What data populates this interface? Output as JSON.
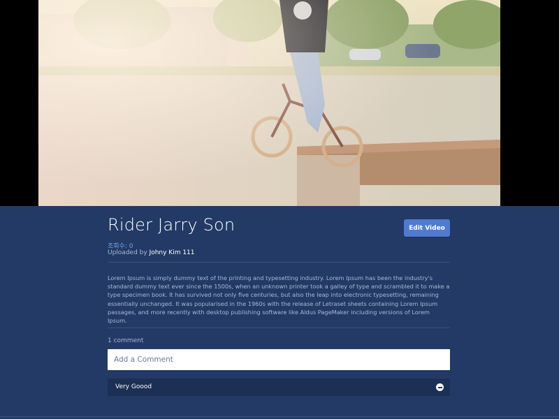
{
  "video": {
    "title": "Rider Jarry Son",
    "views_label": "조회수: 0",
    "uploaded_prefix": "Uploaded by ",
    "uploader": "Johny Kim 111",
    "edit_label": "Edit Video",
    "description": "Lorem Ipsum is simply dummy text of the printing and typesetting industry. Lorem Ipsum has been the industry's standard dummy text ever since the 1500s, when an unknown printer took a galley of type and scrambled it to make a type specimen book. It has survived not only five centuries, but also the leap into electronic typesetting, remaining essentially unchanged. It was popularised in the 1960s with the release of Letraset sheets containing Lorem Ipsum passages, and more recently with desktop publishing software like Aldus PageMaker including versions of Lorem Ipsum."
  },
  "comments": {
    "count_label": "1 comment",
    "input_placeholder": "Add a Comment",
    "input_value": "",
    "items": [
      {
        "text": "Very Goood",
        "action_icon": "minus-circle-icon"
      }
    ]
  },
  "colors": {
    "background": "#233a66",
    "accent": "#4f7bd0",
    "link": "#6ea4f2",
    "comment_bg": "#1c2f55"
  }
}
